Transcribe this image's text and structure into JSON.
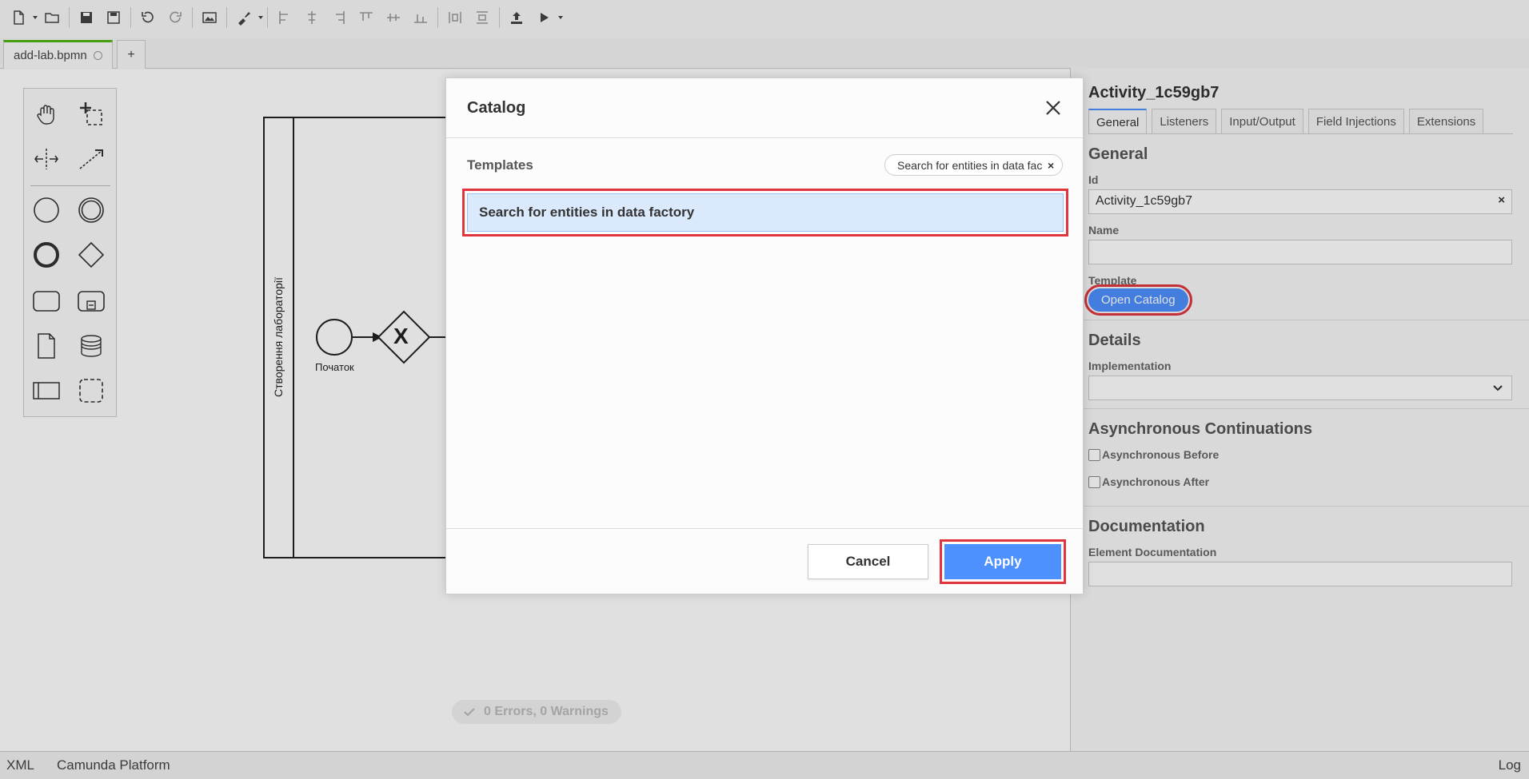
{
  "tabs": {
    "active_file": "add-lab.bpmn",
    "new_tab": "+"
  },
  "diagram": {
    "lane_label": "Створення лабораторії",
    "start_event_label": "Початок",
    "gateway_symbol": "X"
  },
  "validation": {
    "status": "0 Errors, 0 Warnings"
  },
  "modal": {
    "title": "Catalog",
    "templates_label": "Templates",
    "search_value": "Search for entities in data fac",
    "search_clear": "×",
    "result_item": "Search for entities in data factory",
    "cancel_label": "Cancel",
    "apply_label": "Apply"
  },
  "properties": {
    "element_id_title": "Activity_1c59gb7",
    "tabs": [
      "General",
      "Listeners",
      "Input/Output",
      "Field Injections",
      "Extensions"
    ],
    "general_heading": "General",
    "id_label": "Id",
    "id_value": "Activity_1c59gb7",
    "id_clear": "×",
    "name_label": "Name",
    "template_label": "Template",
    "open_catalog_label": "Open Catalog",
    "details_heading": "Details",
    "implementation_label": "Implementation",
    "async_heading": "Asynchronous Continuations",
    "async_before_label": "Asynchronous Before",
    "async_after_label": "Asynchronous After",
    "documentation_heading": "Documentation",
    "element_doc_label": "Element Documentation"
  },
  "statusbar": {
    "xml": "XML",
    "platform": "Camunda Platform",
    "log": "Log"
  },
  "colors": {
    "accent_blue": "#4d90fe",
    "highlight_red": "#e0353f",
    "selected_row": "#dbe9fd",
    "tab_active_green": "#52b415"
  }
}
